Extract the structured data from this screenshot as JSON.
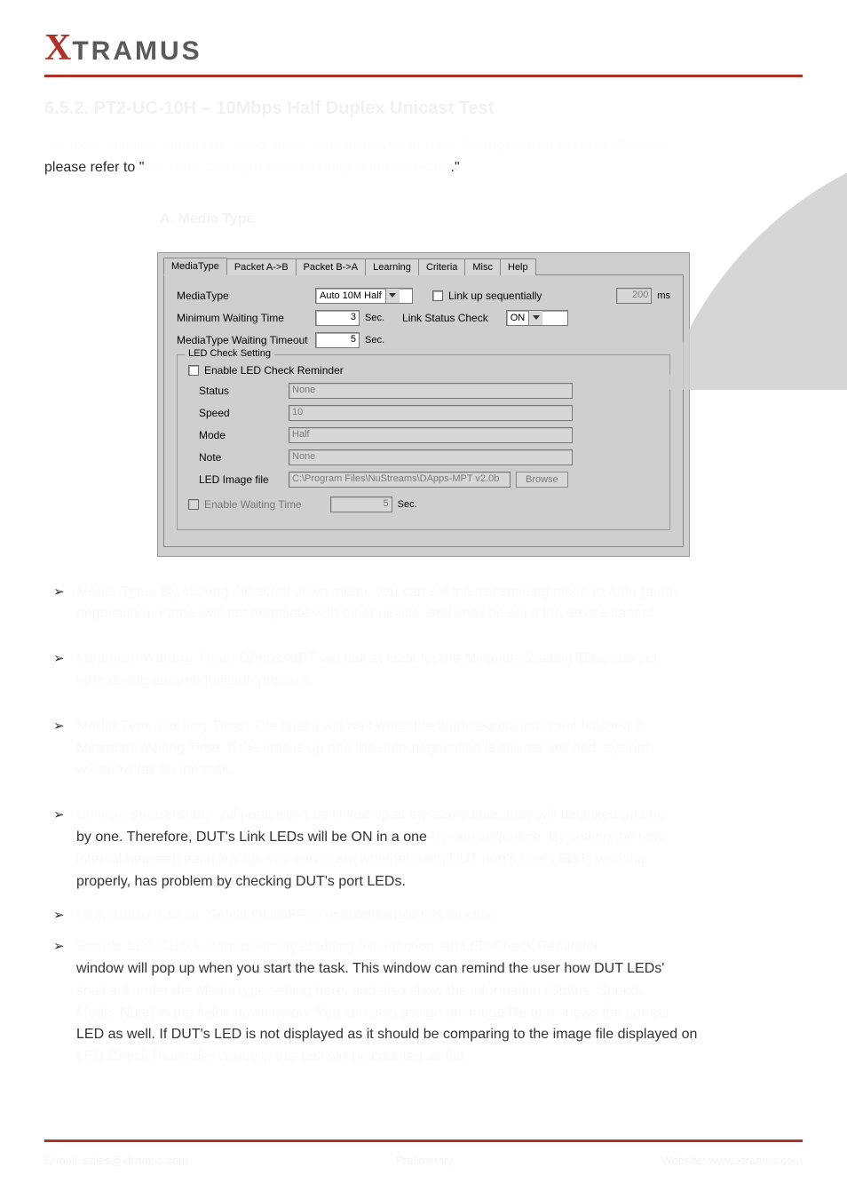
{
  "logo": {
    "x": "X",
    "rest": "TRAMUS"
  },
  "section_title": "6.5.2. PT2-UC-10H – 10Mbps Half Duplex Unicast Test",
  "intro": {
    "l1_pre": "For more detailed information about basic tests displayed on ",
    "l1_hidden_mid": "Test Configuration Display Window",
    "l1_suffix": ", ",
    "l2_prefix": "please refer to ",
    "l2_quote_open": "\"",
    "l2_hidden": "5.5. Test Configuration Display Window (P.38)",
    "l2_quote_close": ".\""
  },
  "caption": "A. Media Type",
  "dialog": {
    "tabs": [
      "MediaType",
      "Packet A->B",
      "Packet B->A",
      "Learning",
      "Criteria",
      "Misc",
      "Help"
    ],
    "mediaType": {
      "label": "MediaType",
      "value": "Auto 10M Half"
    },
    "linkSeq": "Link up sequentially",
    "linkSeqVal": "200",
    "linkSeqUnit": "ms",
    "minWait": {
      "label": "Minimum Waiting Time",
      "value": "3",
      "unit": "Sec."
    },
    "linkStatus": {
      "label": "Link Status Check",
      "value": "ON"
    },
    "timeout": {
      "label": "MediaType Waiting Timeout",
      "value": "5",
      "unit": "Sec."
    },
    "led": {
      "legend": "LED Check Setting",
      "enable": "Enable LED Check Reminder",
      "status": {
        "label": "Status",
        "value": "None"
      },
      "speed": {
        "label": "Speed",
        "value": "10"
      },
      "mode": {
        "label": "Mode",
        "value": "Half"
      },
      "note": {
        "label": "Note",
        "value": "None"
      },
      "image": {
        "label": "LED Image file",
        "value": "C:\\Program Files\\NuStreams\\DApps-MPT v2.0b",
        "btn": "Browse"
      },
      "wait": {
        "label": "Enable Waiting Time",
        "value": "5",
        "unit": "Sec."
      }
    }
  },
  "bullets": [
    {
      "lead": "Media Type:",
      "hidden1": " By clicking the scroll-down menu, you can set the transmitting mode to Auto (auto-",
      "hidden2": "negotiation), Force (will not negotiate with other device, and shall be set if the device cannot"
    },
    {
      "lead": "Minimum Waiting Time:",
      "hidden1": " DApps-MPT will halt at least for the Minimum Waiting Time you set",
      "hidden2": "here during auto-negotiation process."
    },
    {
      "lead": "Media Type Waiting Time:",
      "hidden1": " The time it will wait when the auto-negotiation is not finished in",
      "hidden2": "Minimum Waiting Time. If the time is up and the auto-negotiation is still not finished, system",
      "hidden3": "will show fail on the task.    "
    },
    {
      "lead": "Link up sequentially:",
      "hidden1": " All ports won't be linked up at the same time; they will be linked up one",
      "vis1": "by one. Therefore, DUT's Link LEDs will be ON in a one",
      "hidden2": "-by-one sequence. By setting the time",
      "hidden3": "interval between each link up, you can exam whether each DUT port's Link LED is working",
      "vis2": "properly, has problem by checking DUT's port LEDs."
    },
    {
      "lead": "Link Status Check:",
      "hidden1": " Select ON/OFF to enable/disable this function."
    },
    {
      "lead": "Enable LED Check Reminder:",
      "hidden1": " By enabling this function, an LED Check Reminder",
      "vis1": "window will pop up when you start the task. This window can remind the user how DUT LEDs' ",
      "hidden2": "shall act under the MediaType setting here, and also show the information (Status, Speed,",
      "hidden3": "Mode, Note) in the fields down below. You can also assign an image file that shows the correct",
      "vis2": "LED as well. If DUT's LED is not displayed as it should be comparing to the image file displayed on ",
      "hidden4": "LED Check Reminder Window, this test will be counted as fail."
    }
  ],
  "footer": {
    "left": "E-mail: sales@xtramus.com",
    "center": "Preliminary",
    "right": "Website: www.xtramus.com"
  },
  "wm_label": "Preliminary watermark"
}
